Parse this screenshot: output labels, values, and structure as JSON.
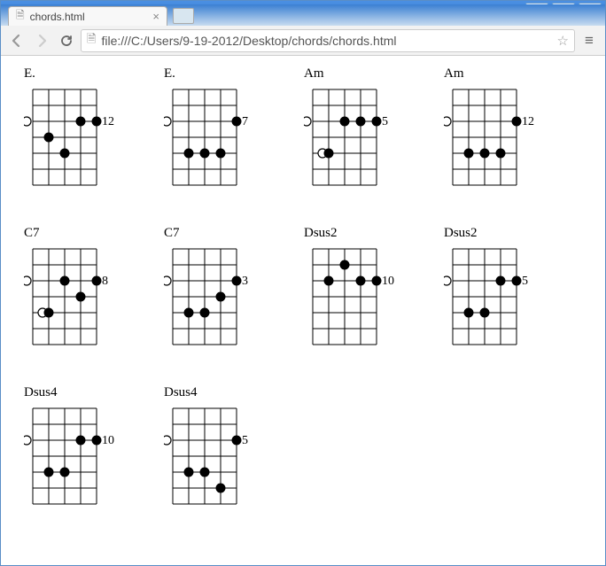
{
  "window": {
    "minimize": "─",
    "maximize": "▢",
    "close": "✕"
  },
  "browser": {
    "tab_title": "chords.html",
    "url": "file:///C:/Users/9-19-2012/Desktop/chords/chords.html"
  },
  "chart_data": [
    {
      "name": "E.",
      "fret_label": "12",
      "open": [
        0
      ],
      "dots": [
        [
          3,
          1
        ],
        [
          4,
          2
        ],
        [
          2,
          3
        ],
        [
          2,
          4
        ]
      ]
    },
    {
      "name": "E.",
      "fret_label": "7",
      "open": [
        0
      ],
      "dots": [
        [
          4,
          1
        ],
        [
          4,
          2
        ],
        [
          4,
          3
        ],
        [
          2,
          4
        ]
      ]
    },
    {
      "name": "Am",
      "fret_label": "5",
      "open": [
        0
      ],
      "dots": [
        [
          4,
          1
        ],
        [
          2,
          2
        ],
        [
          2,
          3
        ],
        [
          2,
          4
        ]
      ]
    },
    {
      "name": "Am",
      "fret_label": "12",
      "open": [
        0
      ],
      "dots": [
        [
          4,
          1
        ],
        [
          4,
          2
        ],
        [
          4,
          3
        ],
        [
          2,
          4
        ]
      ]
    },
    {
      "name": "C7",
      "fret_label": "8",
      "open": [
        0
      ],
      "dots": [
        [
          4,
          1
        ],
        [
          2,
          2
        ],
        [
          3,
          3
        ],
        [
          2,
          4
        ]
      ]
    },
    {
      "name": "C7",
      "fret_label": "3",
      "open": [
        0
      ],
      "dots": [
        [
          4,
          1
        ],
        [
          4,
          2
        ],
        [
          3,
          3
        ],
        [
          2,
          4
        ]
      ]
    },
    {
      "name": "Dsus2",
      "fret_label": "10",
      "open": [],
      "dots": [
        [
          2,
          1
        ],
        [
          1,
          2
        ],
        [
          2,
          3
        ],
        [
          2,
          4
        ]
      ]
    },
    {
      "name": "Dsus2",
      "fret_label": "5",
      "open": [
        0
      ],
      "dots": [
        [
          4,
          1
        ],
        [
          4,
          2
        ],
        [
          2,
          3
        ],
        [
          2,
          4
        ]
      ]
    },
    {
      "name": "Dsus4",
      "fret_label": "10",
      "open": [
        0
      ],
      "dots": [
        [
          4,
          1
        ],
        [
          4,
          2
        ],
        [
          2,
          3
        ],
        [
          2,
          4
        ]
      ]
    },
    {
      "name": "Dsus4",
      "fret_label": "5",
      "open": [
        0
      ],
      "dots": [
        [
          4,
          1
        ],
        [
          4,
          2
        ],
        [
          5,
          3
        ],
        [
          2,
          4
        ]
      ]
    }
  ]
}
